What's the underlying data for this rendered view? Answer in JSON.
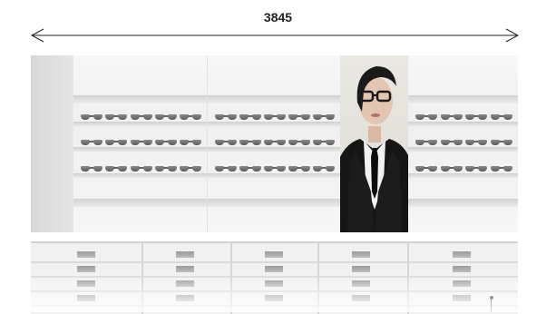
{
  "dimension": {
    "label": "3845"
  },
  "portrait": {
    "name": "model-with-glasses-graphic"
  },
  "display": {
    "shelf_rows": 3,
    "panels": 3
  }
}
